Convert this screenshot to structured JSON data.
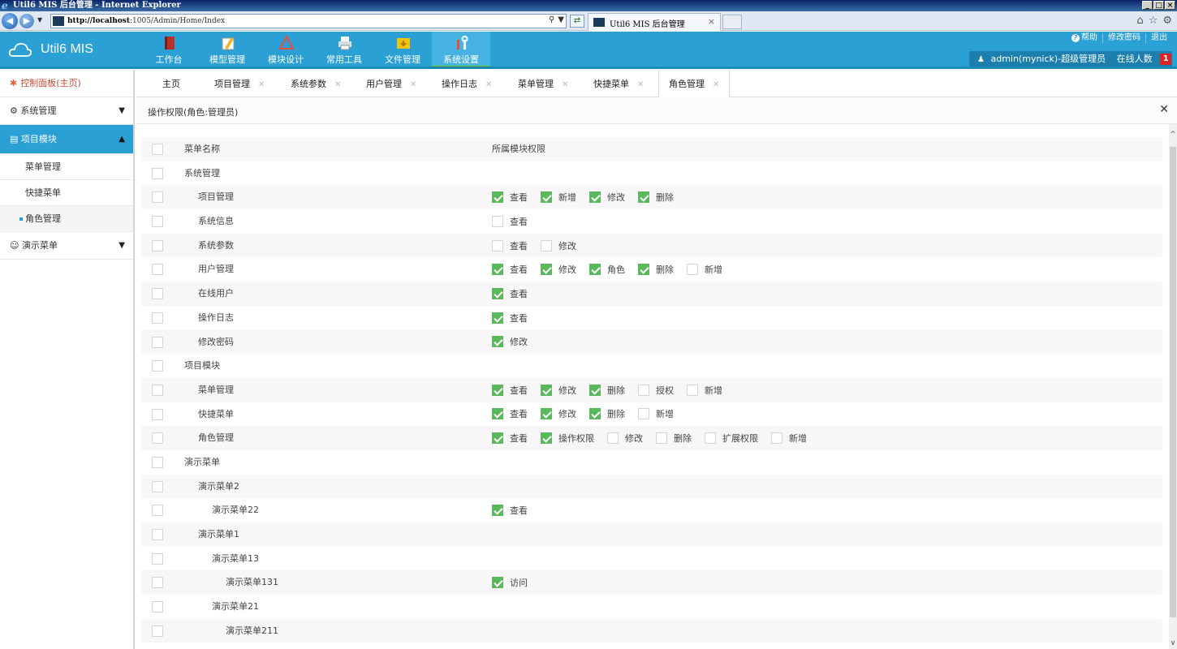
{
  "browser": {
    "window_title": "Util6 MIS 后台管理 - Internet Explorer",
    "url_host": "http://localhost",
    "url_path": ":1005/Admin/Home/Index",
    "tab_title": "Util6 MIS 后台管理"
  },
  "header": {
    "app_name": "Util6 MIS",
    "modules": [
      {
        "label": "工作台",
        "icon": "book-icon",
        "color": "#c0392b"
      },
      {
        "label": "模型管理",
        "icon": "pencil-icon",
        "color": "#f0b429"
      },
      {
        "label": "模块设计",
        "icon": "design-icon",
        "color": "#e74c3c"
      },
      {
        "label": "常用工具",
        "icon": "printer-icon",
        "color": "#ecf0f1"
      },
      {
        "label": "文件管理",
        "icon": "folder-icon",
        "color": "#f1c40f"
      },
      {
        "label": "系统设置",
        "icon": "tools-icon",
        "color": "#e74c3c",
        "active": true
      }
    ],
    "links": [
      "帮助",
      "修改密码",
      "退出"
    ],
    "user": "admin(mynick)-超级管理员",
    "online_label": "在线人数",
    "online_count": "1"
  },
  "sidebar": {
    "dashboard": "控制面板(主页)",
    "system_mgmt": "系统管理",
    "project_module": "项目模块",
    "project_items": [
      "菜单管理",
      "快捷菜单",
      "角色管理"
    ],
    "demo_menu": "演示菜单"
  },
  "tabs": [
    "主页",
    "项目管理",
    "系统参数",
    "用户管理",
    "操作日志",
    "菜单管理",
    "快捷菜单",
    "角色管理"
  ],
  "panel": {
    "title": "操作权限(角色:管理员)",
    "col_name": "菜单名称",
    "col_perms": "所属模块权限"
  },
  "rows": [
    {
      "name": "系统管理",
      "level": 0,
      "perms": []
    },
    {
      "name": "项目管理",
      "level": 1,
      "perms": [
        {
          "l": "查看",
          "c": true
        },
        {
          "l": "新增",
          "c": true
        },
        {
          "l": "修改",
          "c": true
        },
        {
          "l": "删除",
          "c": true
        }
      ]
    },
    {
      "name": "系统信息",
      "level": 1,
      "perms": [
        {
          "l": "查看",
          "c": false
        }
      ]
    },
    {
      "name": "系统参数",
      "level": 1,
      "perms": [
        {
          "l": "查看",
          "c": false
        },
        {
          "l": "修改",
          "c": false
        }
      ]
    },
    {
      "name": "用户管理",
      "level": 1,
      "perms": [
        {
          "l": "查看",
          "c": true
        },
        {
          "l": "修改",
          "c": true
        },
        {
          "l": "角色",
          "c": true
        },
        {
          "l": "删除",
          "c": true
        },
        {
          "l": "新增",
          "c": false
        }
      ]
    },
    {
      "name": "在线用户",
      "level": 1,
      "perms": [
        {
          "l": "查看",
          "c": true
        }
      ]
    },
    {
      "name": "操作日志",
      "level": 1,
      "perms": [
        {
          "l": "查看",
          "c": true
        }
      ]
    },
    {
      "name": "修改密码",
      "level": 1,
      "perms": [
        {
          "l": "修改",
          "c": true
        }
      ]
    },
    {
      "name": "项目模块",
      "level": 0,
      "perms": []
    },
    {
      "name": "菜单管理",
      "level": 1,
      "perms": [
        {
          "l": "查看",
          "c": true
        },
        {
          "l": "修改",
          "c": true
        },
        {
          "l": "删除",
          "c": true
        },
        {
          "l": "授权",
          "c": false
        },
        {
          "l": "新增",
          "c": false
        }
      ]
    },
    {
      "name": "快捷菜单",
      "level": 1,
      "perms": [
        {
          "l": "查看",
          "c": true
        },
        {
          "l": "修改",
          "c": true
        },
        {
          "l": "删除",
          "c": true
        },
        {
          "l": "新增",
          "c": false
        }
      ]
    },
    {
      "name": "角色管理",
      "level": 1,
      "perms": [
        {
          "l": "查看",
          "c": true
        },
        {
          "l": "操作权限",
          "c": true
        },
        {
          "l": "修改",
          "c": false
        },
        {
          "l": "删除",
          "c": false
        },
        {
          "l": "扩展权限",
          "c": false
        },
        {
          "l": "新增",
          "c": false
        }
      ]
    },
    {
      "name": "演示菜单",
      "level": 0,
      "perms": []
    },
    {
      "name": "演示菜单2",
      "level": 1,
      "perms": []
    },
    {
      "name": "演示菜单22",
      "level": 2,
      "perms": [
        {
          "l": "查看",
          "c": true
        }
      ]
    },
    {
      "name": "演示菜单1",
      "level": 1,
      "perms": []
    },
    {
      "name": "演示菜单13",
      "level": 2,
      "perms": []
    },
    {
      "name": "演示菜单131",
      "level": 3,
      "perms": [
        {
          "l": "访问",
          "c": true
        }
      ]
    },
    {
      "name": "演示菜单21",
      "level": 2,
      "perms": []
    },
    {
      "name": "演示菜单211",
      "level": 3,
      "perms": []
    }
  ]
}
